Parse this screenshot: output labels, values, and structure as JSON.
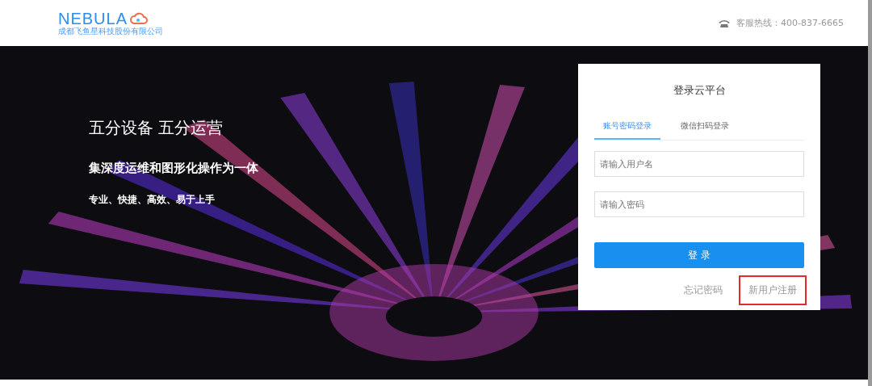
{
  "header": {
    "logo": "NEBULA",
    "company": "成都飞鱼星科技股份有限公司",
    "hotline": "客服热线：400-837-6665"
  },
  "hero": {
    "title": "五分设备 五分运营",
    "subtitle": "集深度运维和图形化操作为一体",
    "tagline": "专业、快捷、高效、易于上手"
  },
  "login": {
    "title": "登录云平台",
    "tabs": [
      {
        "label": "账号密码登录",
        "selected": true
      },
      {
        "label": "微信扫码登录",
        "selected": false
      }
    ],
    "fields": [
      {
        "placeholder": "请输入用户名"
      },
      {
        "placeholder": "请输入密码"
      }
    ],
    "submit": "登 录",
    "links": [
      {
        "label": "忘记密码",
        "highlighted": false
      },
      {
        "label": "新用户注册",
        "highlighted": true
      }
    ]
  }
}
